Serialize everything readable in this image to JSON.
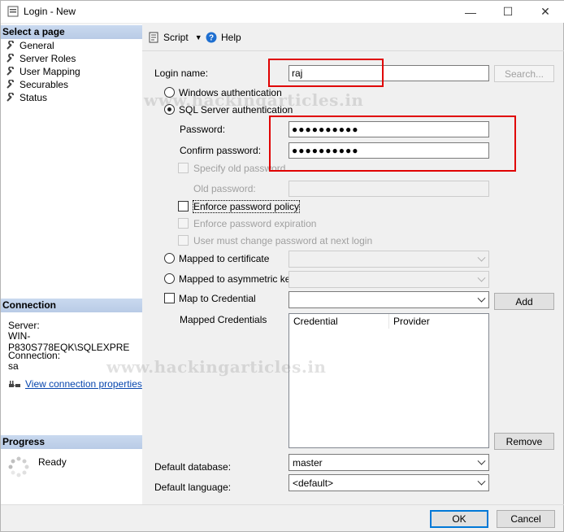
{
  "window": {
    "title": "Login - New",
    "minimize": "—",
    "maximize": "☐",
    "close": "✕"
  },
  "sidebar": {
    "select_page_header": "Select a page",
    "pages": [
      "General",
      "Server Roles",
      "User Mapping",
      "Securables",
      "Status"
    ],
    "connection_header": "Connection",
    "server_label": "Server:",
    "server_value": "WIN-P830S778EQK\\SQLEXPRE",
    "connection_label": "Connection:",
    "connection_value": "sa",
    "view_link": "View connection properties",
    "progress_header": "Progress",
    "progress_status": "Ready"
  },
  "toolbar": {
    "script_label": "Script",
    "help_label": "Help"
  },
  "form": {
    "login_name_label": "Login name:",
    "login_name_value": "raj",
    "search_button": "Search...",
    "windows_auth": "Windows authentication",
    "sql_auth": "SQL Server authentication",
    "password_label": "Password:",
    "password_value": "●●●●●●●●●●",
    "confirm_label": "Confirm password:",
    "confirm_value": "●●●●●●●●●●",
    "specify_old": "Specify old password",
    "old_password_label": "Old password:",
    "enforce_policy": "Enforce password policy",
    "enforce_expiration": "Enforce password expiration",
    "must_change": "User must change password at next login",
    "mapped_cert": "Mapped to certificate",
    "mapped_asym": "Mapped to asymmetric key",
    "map_credential": "Map to Credential",
    "add_button": "Add",
    "mapped_credentials_label": "Mapped Credentials",
    "col_credential": "Credential",
    "col_provider": "Provider",
    "remove_button": "Remove",
    "default_db_label": "Default database:",
    "default_db_value": "master",
    "default_lang_label": "Default language:",
    "default_lang_value": "<default>"
  },
  "footer": {
    "ok": "OK",
    "cancel": "Cancel"
  },
  "watermark": "www.hackingarticles.in",
  "colors": {
    "highlight_box": "#e00000",
    "section_header": "#c9d9ef",
    "link": "#0645ad"
  }
}
